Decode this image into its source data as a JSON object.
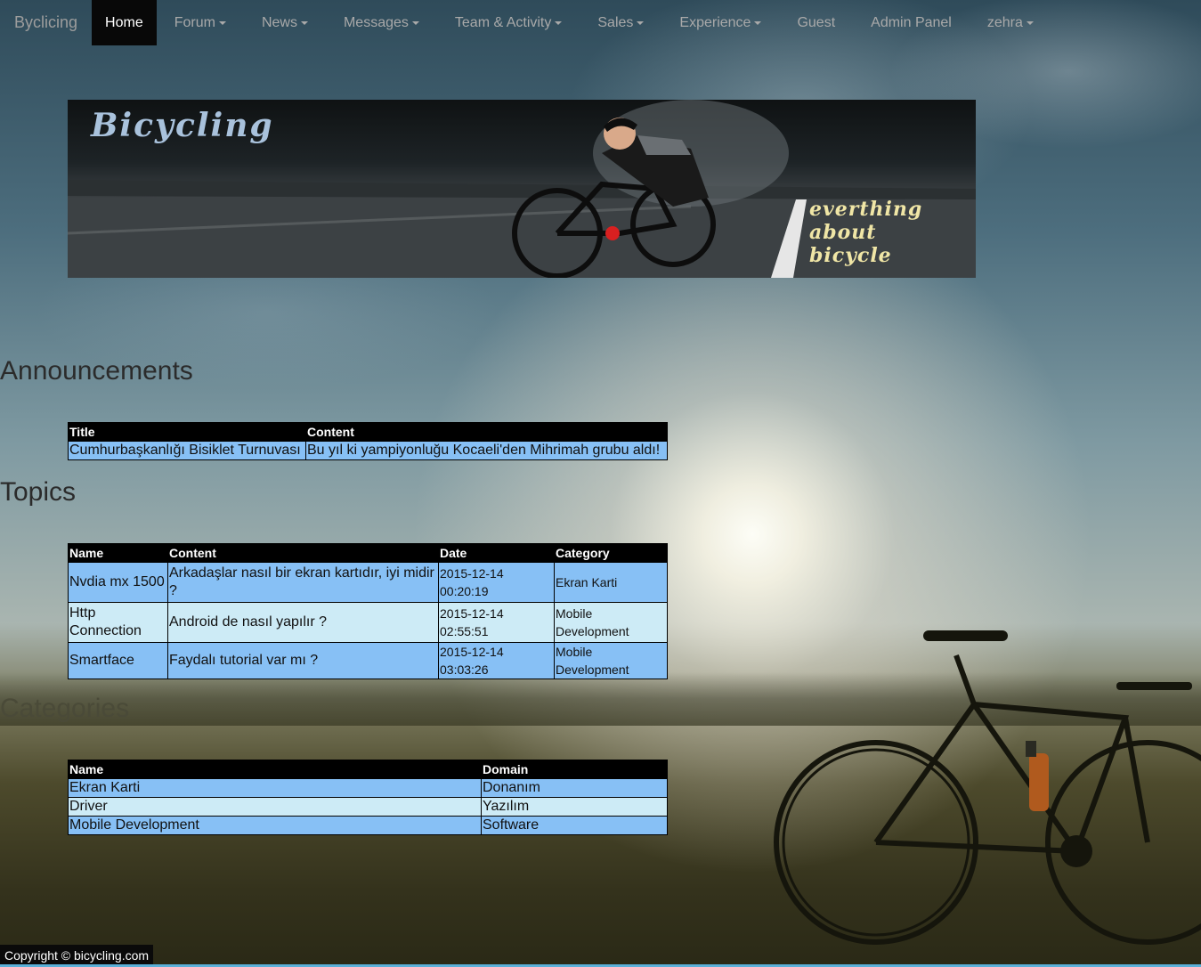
{
  "navbar": {
    "brand": "Byclicing",
    "items": [
      {
        "label": "Home",
        "active": true,
        "dropdown": false
      },
      {
        "label": "Forum",
        "dropdown": true
      },
      {
        "label": "News",
        "dropdown": true
      },
      {
        "label": "Messages",
        "dropdown": true
      },
      {
        "label": "Team & Activity",
        "dropdown": true
      },
      {
        "label": "Sales",
        "dropdown": true
      },
      {
        "label": "Experience",
        "dropdown": true
      },
      {
        "label": "Guest",
        "dropdown": false
      },
      {
        "label": "Admin Panel",
        "dropdown": false
      },
      {
        "label": "zehra",
        "dropdown": true
      }
    ]
  },
  "banner": {
    "title": "Bicycling",
    "tagline_lines": [
      "everthing",
      "about",
      "bicycle"
    ]
  },
  "announcements": {
    "heading": "Announcements",
    "columns": [
      "Title",
      "Content"
    ],
    "rows": [
      {
        "title": "Cumhurbaşkanlığı Bisiklet Turnuvası",
        "content": "Bu yıl ki yampiyonluğu Kocaeli'den Mihrimah grubu aldı!"
      }
    ]
  },
  "topics": {
    "heading": "Topics",
    "columns": [
      "Name",
      "Content",
      "Date",
      "Category"
    ],
    "rows": [
      {
        "name": "Nvdia mx 1500",
        "content": "Arkadaşlar nasıl bir ekran kartıdır, iyi midir ?",
        "date": "2015-12-14 00:20:19",
        "category": "Ekran Karti"
      },
      {
        "name": "Http Connection",
        "content": "Android de nasıl yapılır ?",
        "date": "2015-12-14 02:55:51",
        "category": "Mobile Development"
      },
      {
        "name": "Smartface",
        "content": "Faydalı tutorial var mı ?",
        "date": "2015-12-14 03:03:26",
        "category": "Mobile Development"
      }
    ]
  },
  "categories": {
    "heading": "Categories",
    "columns": [
      "Name",
      "Domain"
    ],
    "rows": [
      {
        "name": "Ekran Karti",
        "domain": "Donanım"
      },
      {
        "name": "Driver",
        "domain": "Yazılım"
      },
      {
        "name": "Mobile Development",
        "domain": "Software"
      }
    ]
  },
  "footer": {
    "copyright": "Copyright © bicycling.com"
  },
  "colors": {
    "navbar_active_bg": "#080808",
    "table_header_bg": "#000000",
    "row_odd_bg": "#87c0f5",
    "row_even_bg": "#cdebf6",
    "footer_bg": "#0a0a0a"
  }
}
